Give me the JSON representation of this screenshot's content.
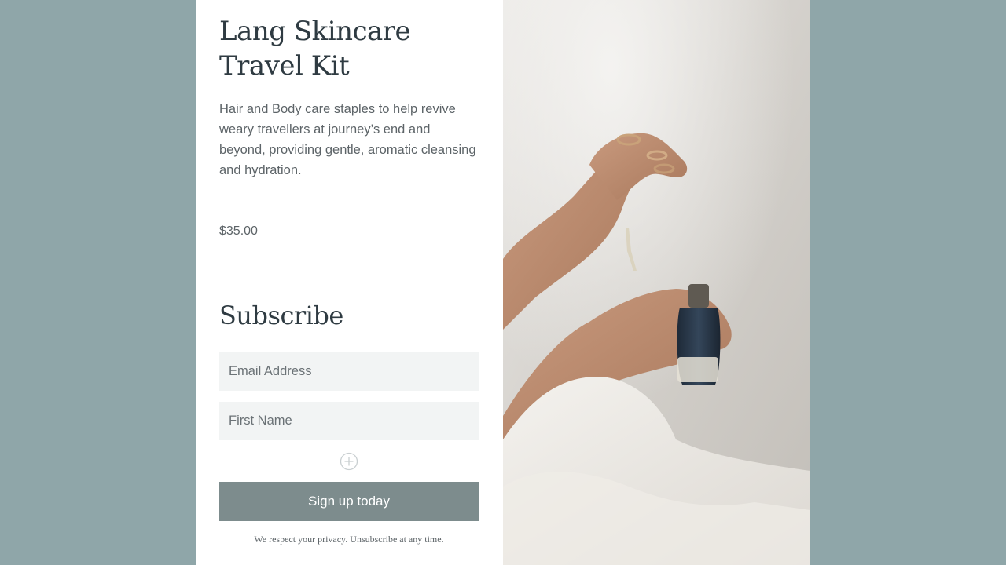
{
  "product": {
    "title": "Lang Skincare Travel Kit",
    "description": "Hair and Body care staples to help revive weary travellers at journey’s end and beyond, providing gentle, aromatic cleansing and hydration.",
    "price": "$35.00"
  },
  "subscribe": {
    "heading": "Subscribe",
    "email_placeholder": "Email Address",
    "first_name_placeholder": "First Name",
    "expand_icon": "plus-circle-icon",
    "button_label": "Sign up today",
    "privacy_note": "We respect your privacy. Unsubscribe at any time."
  },
  "colors": {
    "background": "#8fa6a9",
    "button": "#7d8c8d",
    "field_bg": "#f2f4f4",
    "heading_text": "#2f3b42"
  }
}
